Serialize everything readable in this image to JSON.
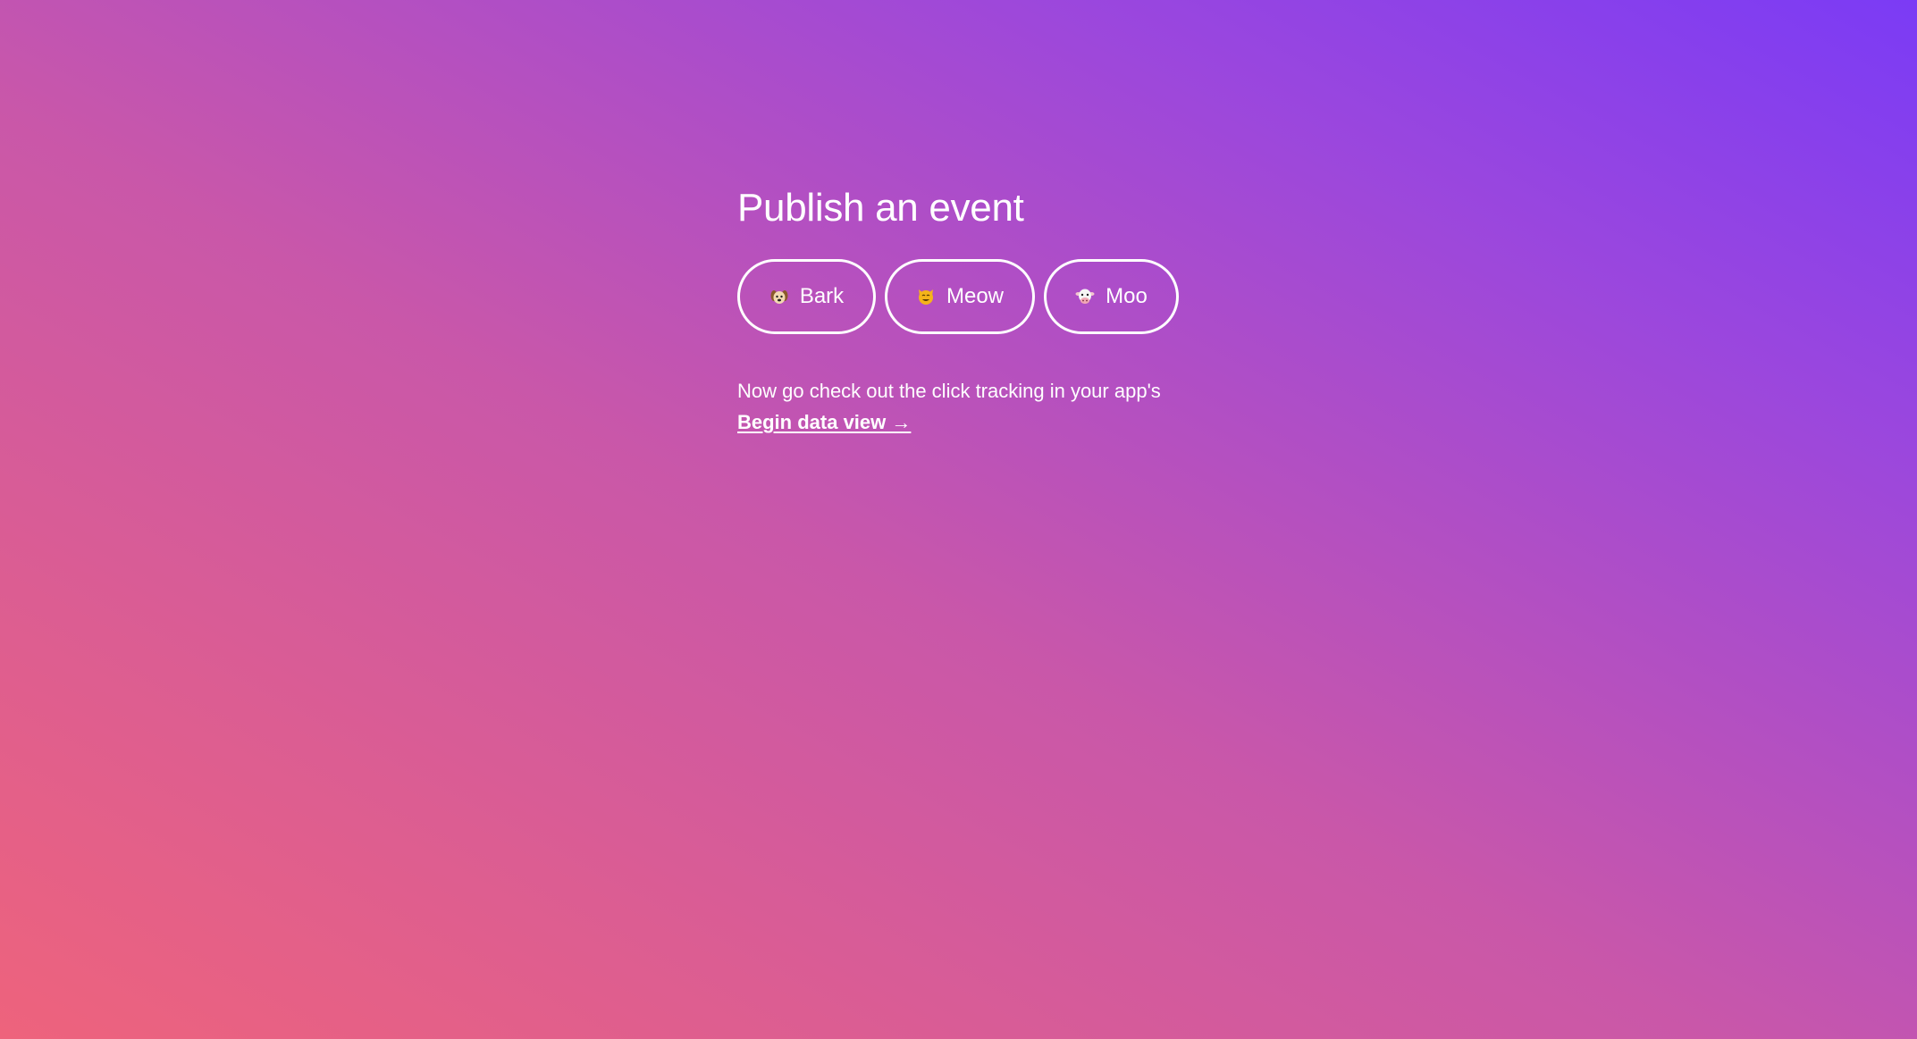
{
  "page": {
    "title": "Publish an event",
    "buttons": [
      {
        "id": "bark",
        "label": "Bark",
        "icon": "dog-face-icon"
      },
      {
        "id": "meow",
        "label": "Meow",
        "icon": "cat-face-icon"
      },
      {
        "id": "moo",
        "label": "Moo",
        "icon": "cow-face-icon"
      }
    ],
    "note": {
      "text": "Now go check out the click tracking in your app's",
      "link_label": "Begin data view →"
    }
  },
  "colors": {
    "gradient_start": "#ee637c",
    "gradient_end": "#7b3bf5",
    "text": "#ffffff"
  }
}
